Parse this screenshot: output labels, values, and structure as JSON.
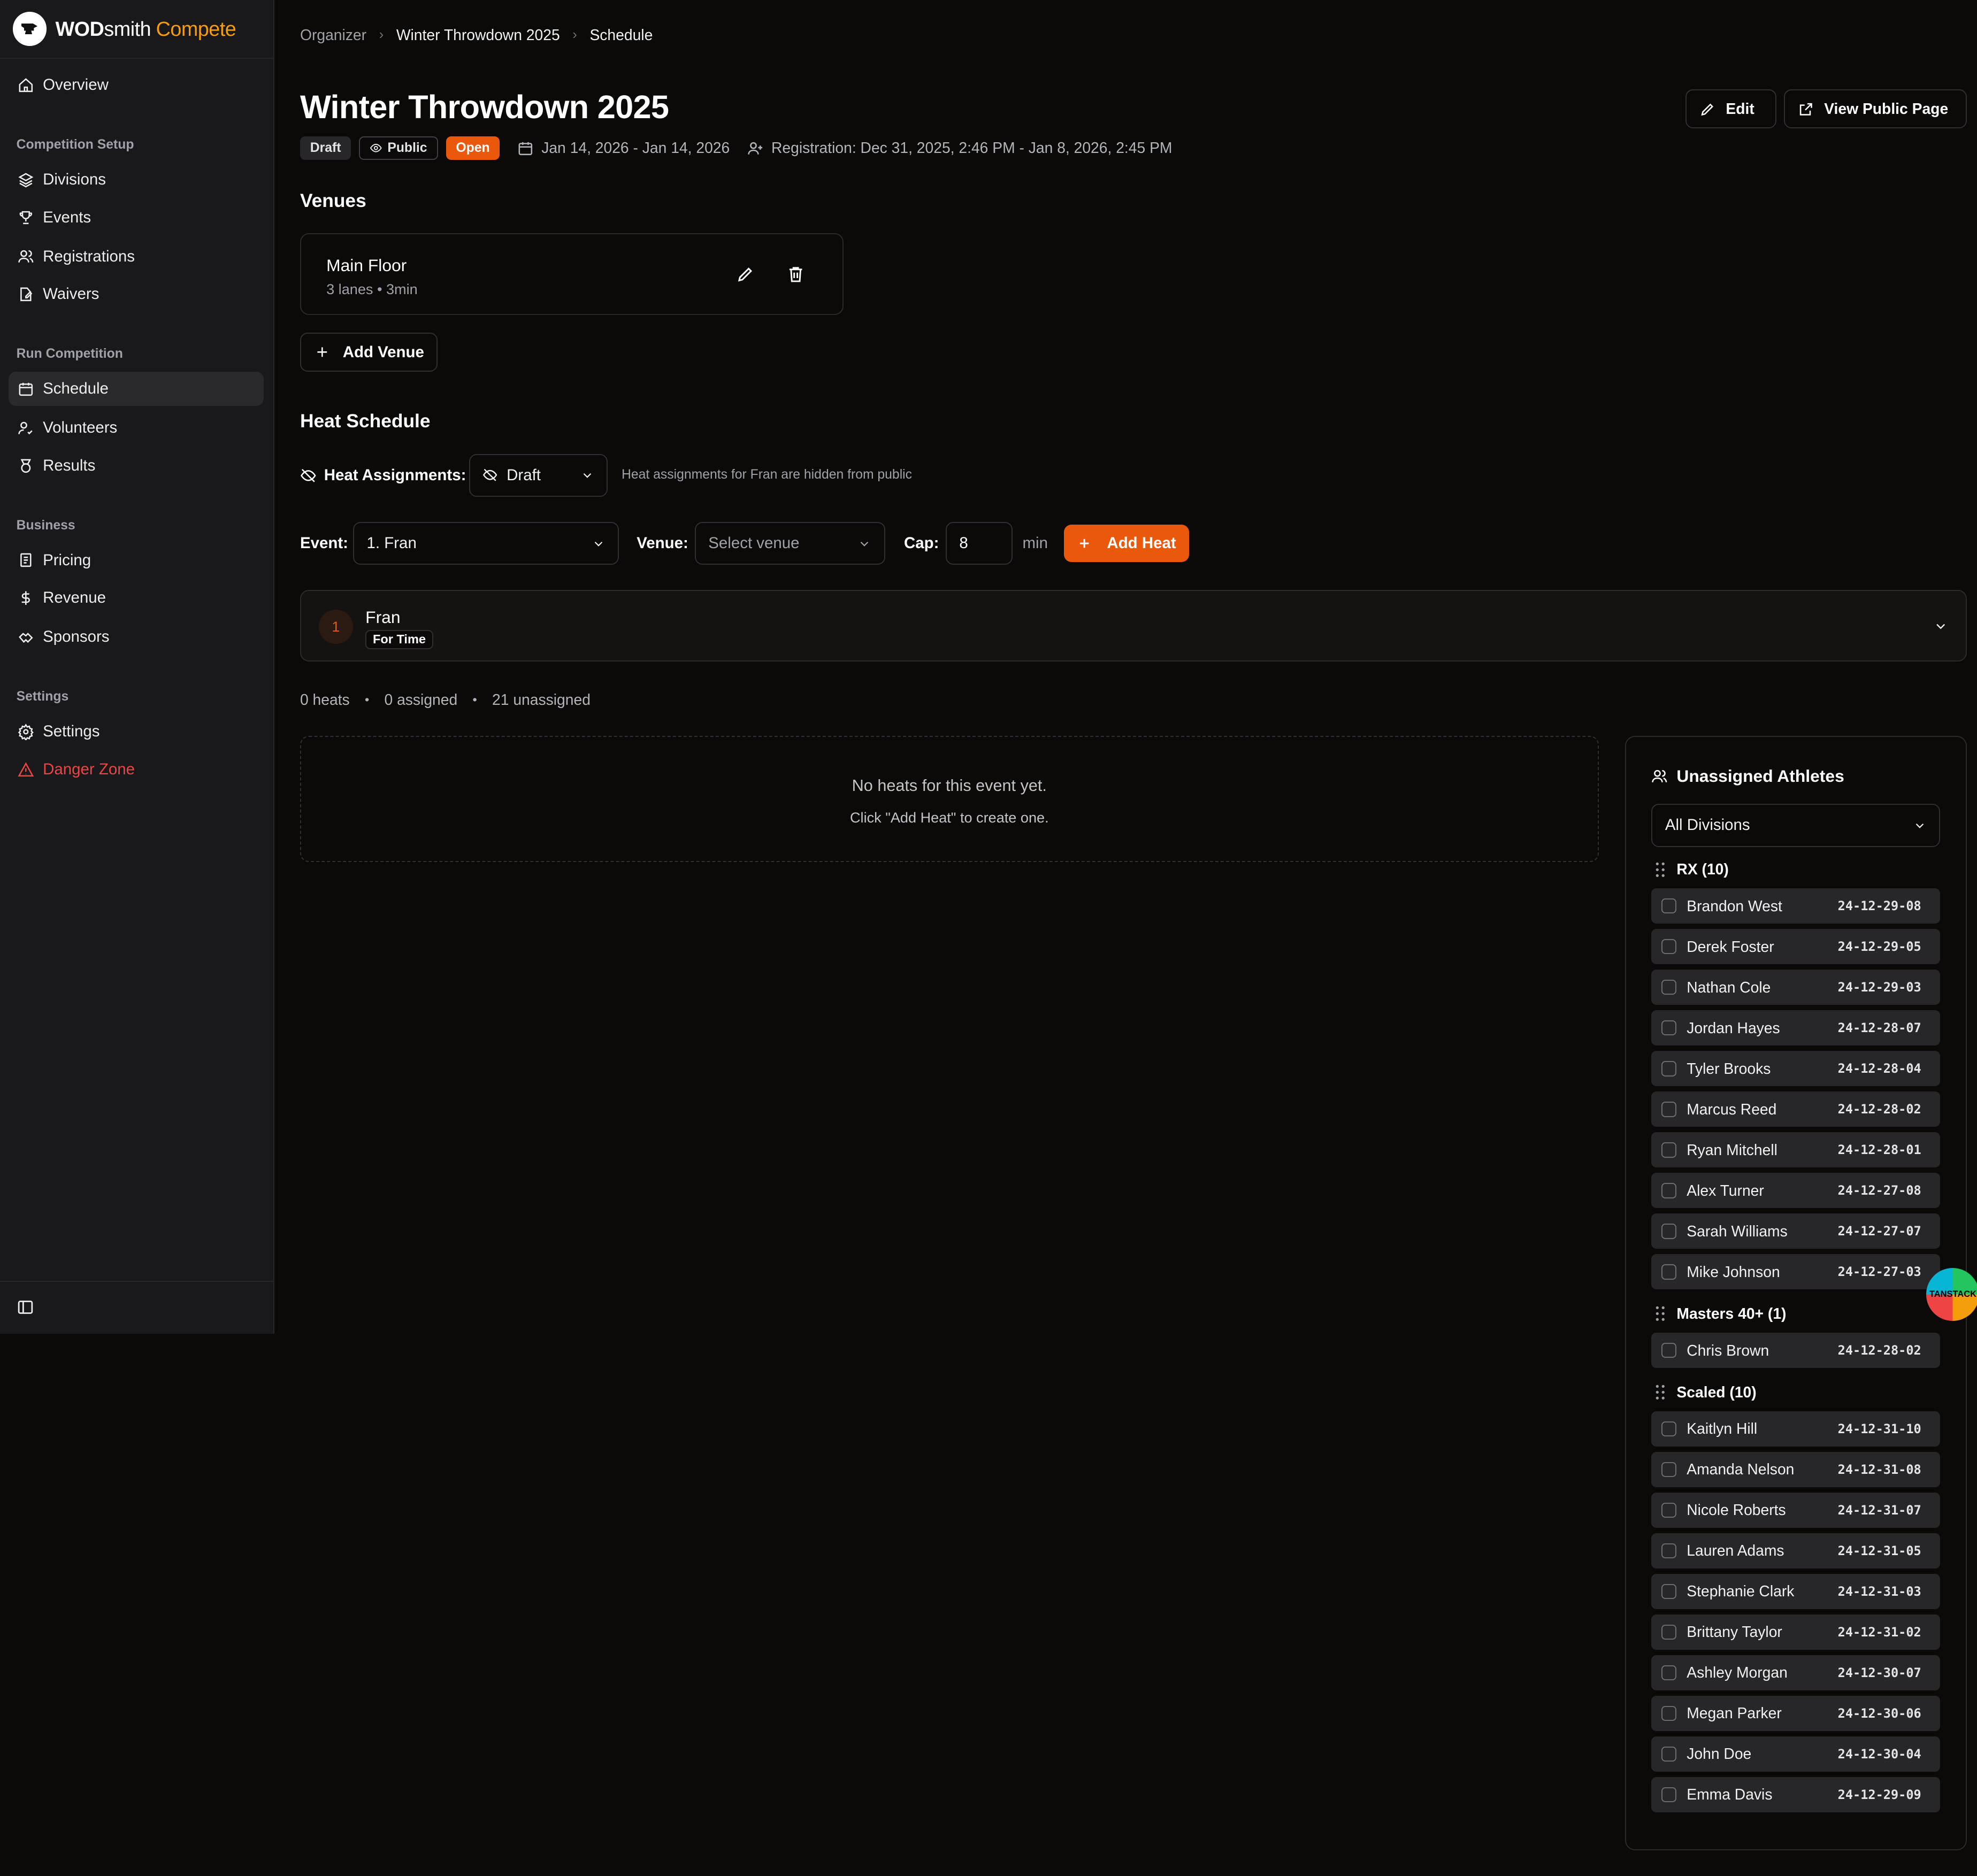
{
  "brand": {
    "part1": "WOD",
    "part2": "smith",
    "part3": "Compete"
  },
  "sidebar": {
    "overview": "Overview",
    "sections": {
      "setup": "Competition Setup",
      "run": "Run Competition",
      "business": "Business",
      "settings": "Settings"
    },
    "items": {
      "divisions": "Divisions",
      "events": "Events",
      "registrations": "Registrations",
      "waivers": "Waivers",
      "schedule": "Schedule",
      "volunteers": "Volunteers",
      "results": "Results",
      "pricing": "Pricing",
      "revenue": "Revenue",
      "sponsors": "Sponsors",
      "settings": "Settings",
      "danger": "Danger Zone"
    },
    "active": "Schedule"
  },
  "breadcrumb": [
    "Organizer",
    "Winter Throwdown 2025",
    "Schedule"
  ],
  "header": {
    "title": "Winter Throwdown 2025",
    "badges": {
      "draft": "Draft",
      "public": "Public",
      "open": "Open"
    },
    "dates": "Jan 14, 2026 - Jan 14, 2026",
    "registration": "Registration: Dec 31, 2025, 2:46 PM - Jan 8, 2026, 2:45 PM",
    "edit": "Edit",
    "view_public": "View Public Page"
  },
  "venues": {
    "heading": "Venues",
    "items": [
      {
        "name": "Main Floor",
        "detail": "3 lanes • 3min"
      }
    ],
    "add": "Add Venue"
  },
  "heat_schedule": {
    "heading": "Heat Schedule",
    "assign_label": "Heat Assignments:",
    "assign_value": "Draft",
    "assign_note": "Heat assignments for Fran are hidden from public",
    "event_label": "Event:",
    "event_value": "1. Fran",
    "venue_label": "Venue:",
    "venue_placeholder": "Select venue",
    "cap_label": "Cap:",
    "cap_value": "8",
    "cap_unit": "min",
    "add_heat": "Add Heat"
  },
  "event": {
    "number": "1",
    "name": "Fran",
    "type": "For Time"
  },
  "stats": {
    "heats": "0 heats",
    "assigned": "0 assigned",
    "unassigned": "21 unassigned"
  },
  "empty": {
    "line1": "No heats for this event yet.",
    "line2": "Click \"Add Heat\" to create one."
  },
  "unassigned": {
    "title": "Unassigned Athletes",
    "filter": "All Divisions",
    "groups": [
      {
        "label": "RX (10)",
        "athletes": [
          {
            "name": "Brandon West",
            "code": "24-12-29-08"
          },
          {
            "name": "Derek Foster",
            "code": "24-12-29-05"
          },
          {
            "name": "Nathan Cole",
            "code": "24-12-29-03"
          },
          {
            "name": "Jordan Hayes",
            "code": "24-12-28-07"
          },
          {
            "name": "Tyler Brooks",
            "code": "24-12-28-04"
          },
          {
            "name": "Marcus Reed",
            "code": "24-12-28-02"
          },
          {
            "name": "Ryan Mitchell",
            "code": "24-12-28-01"
          },
          {
            "name": "Alex Turner",
            "code": "24-12-27-08"
          },
          {
            "name": "Sarah Williams",
            "code": "24-12-27-07"
          },
          {
            "name": "Mike Johnson",
            "code": "24-12-27-03"
          }
        ]
      },
      {
        "label": "Masters 40+ (1)",
        "athletes": [
          {
            "name": "Chris Brown",
            "code": "24-12-28-02"
          }
        ]
      },
      {
        "label": "Scaled (10)",
        "athletes": [
          {
            "name": "Kaitlyn Hill",
            "code": "24-12-31-10"
          },
          {
            "name": "Amanda Nelson",
            "code": "24-12-31-08"
          },
          {
            "name": "Nicole Roberts",
            "code": "24-12-31-07"
          },
          {
            "name": "Lauren Adams",
            "code": "24-12-31-05"
          },
          {
            "name": "Stephanie Clark",
            "code": "24-12-31-03"
          },
          {
            "name": "Brittany Taylor",
            "code": "24-12-31-02"
          },
          {
            "name": "Ashley Morgan",
            "code": "24-12-30-07"
          },
          {
            "name": "Megan Parker",
            "code": "24-12-30-06"
          },
          {
            "name": "John Doe",
            "code": "24-12-30-04"
          },
          {
            "name": "Emma Davis",
            "code": "24-12-29-09"
          }
        ]
      }
    ]
  },
  "devtools_badge": "TANSTACK",
  "colors": {
    "accent": "#ea580c",
    "brand_accent": "#f59e0b",
    "danger": "#ef4444",
    "background": "#0b0a09",
    "sidebar": "#19191b"
  }
}
